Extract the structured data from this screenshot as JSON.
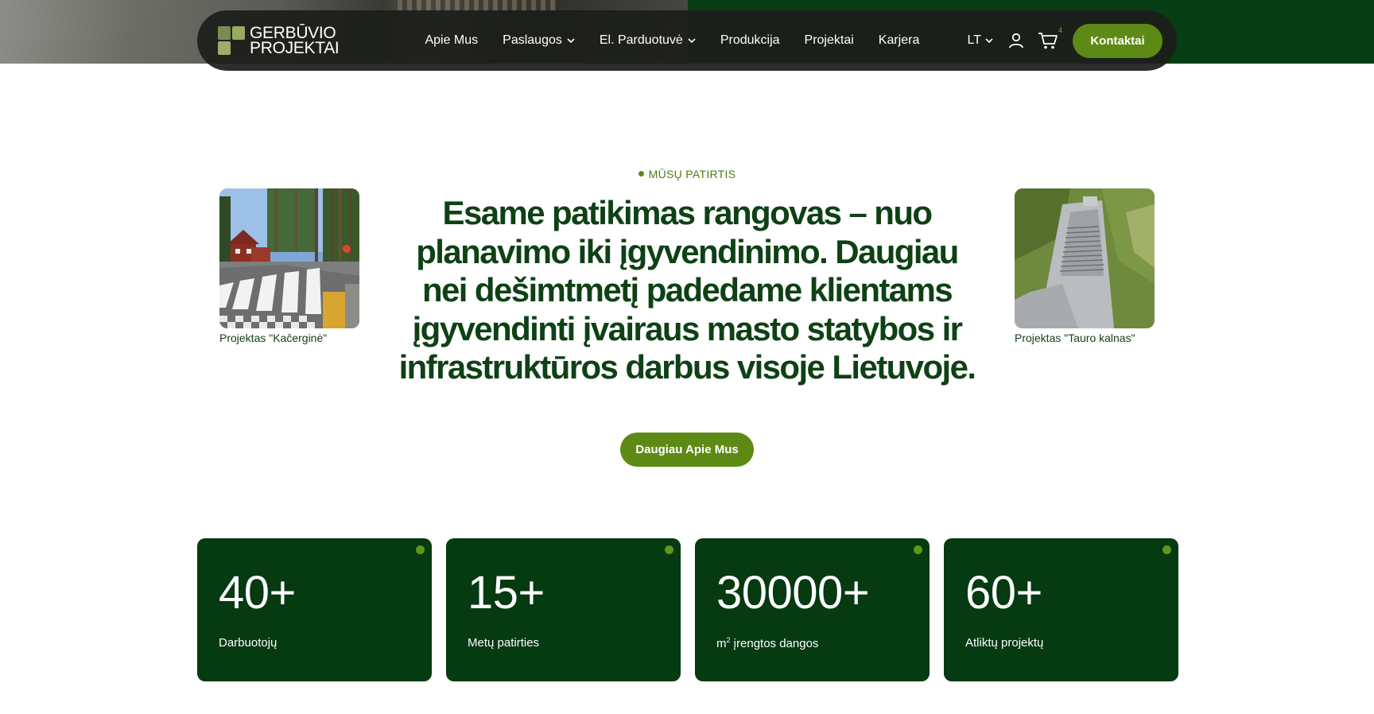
{
  "header": {
    "logo_line1": "GERBŪVIO",
    "logo_line2": "PROJEKTAI",
    "nav": [
      {
        "label": "Apie Mus"
      },
      {
        "label": "Paslaugos"
      },
      {
        "label": "El. Parduotuvė"
      },
      {
        "label": "Produkcija"
      },
      {
        "label": "Projektai"
      },
      {
        "label": "Karjera"
      }
    ],
    "language": "LT",
    "cart_count": "4",
    "contact_label": "Kontaktai"
  },
  "experience": {
    "eyebrow": "MŪSŲ PATIRTIS",
    "headline": "Esame patikimas rangovas – nuo planavimo iki įgyvendinimo. Daugiau nei dešimtmetį padedame klientams įgyvendinti įvairaus masto statybos ir infrastruktūros darbus visoje Lietuvoje.",
    "project_left_caption": "Projektas \"Kačerginė\"",
    "project_right_caption": "Projektas \"Tauro kalnas\"",
    "more_label": "Daugiau Apie Mus"
  },
  "stats": [
    {
      "value": "40+",
      "label": "Darbuotojų"
    },
    {
      "value": "15+",
      "label": "Metų patirties"
    },
    {
      "value": "30000+",
      "label_prefix": "m",
      "label_sup": "2",
      "label": " įrengtos dangos"
    },
    {
      "value": "60+",
      "label": "Atliktų projektų"
    }
  ],
  "colors": {
    "accent_green": "#5d8a15",
    "dark_green": "#063a11",
    "headline_green": "#0e4115",
    "nav_background": "#1c1e1a"
  },
  "icons": [
    "user-icon",
    "cart-icon",
    "chevron-down-icon"
  ]
}
